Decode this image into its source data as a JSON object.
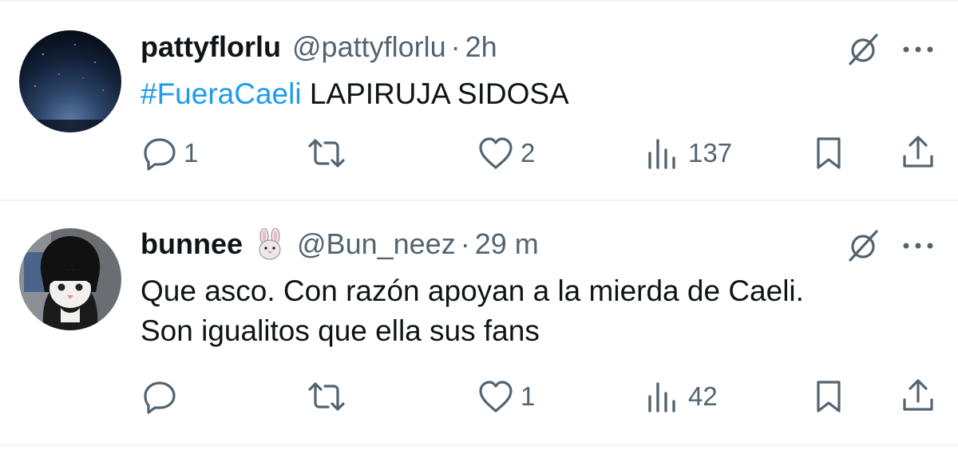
{
  "tweets": [
    {
      "name": "pattyflorlu",
      "handle": "@pattyflorlu",
      "separator": "·",
      "time": "2h",
      "hashtag": "#FueraCaeli",
      "text": "LAPIRUJA SIDOSA",
      "replies": "1",
      "reposts": "",
      "likes": "2",
      "views": "137"
    },
    {
      "name": "bunnee",
      "emoji": "rabbit-face-icon",
      "handle": "@Bun_neez",
      "separator": "·",
      "time": "29 m",
      "text_line1": "Que asco. Con razón apoyan a la mierda de Caeli.",
      "text_line2": "Son igualitos que ella sus fans",
      "replies": "",
      "reposts": "",
      "likes": "1",
      "views": "42"
    }
  ],
  "colors": {
    "text": "#0f1419",
    "secondary": "#536471",
    "hashtag": "#1d9bf0",
    "divider": "#eff3f4"
  },
  "icons": [
    "reply-icon",
    "repost-icon",
    "like-icon",
    "views-icon",
    "bookmark-icon",
    "share-icon",
    "grok-icon",
    "more-icon"
  ]
}
